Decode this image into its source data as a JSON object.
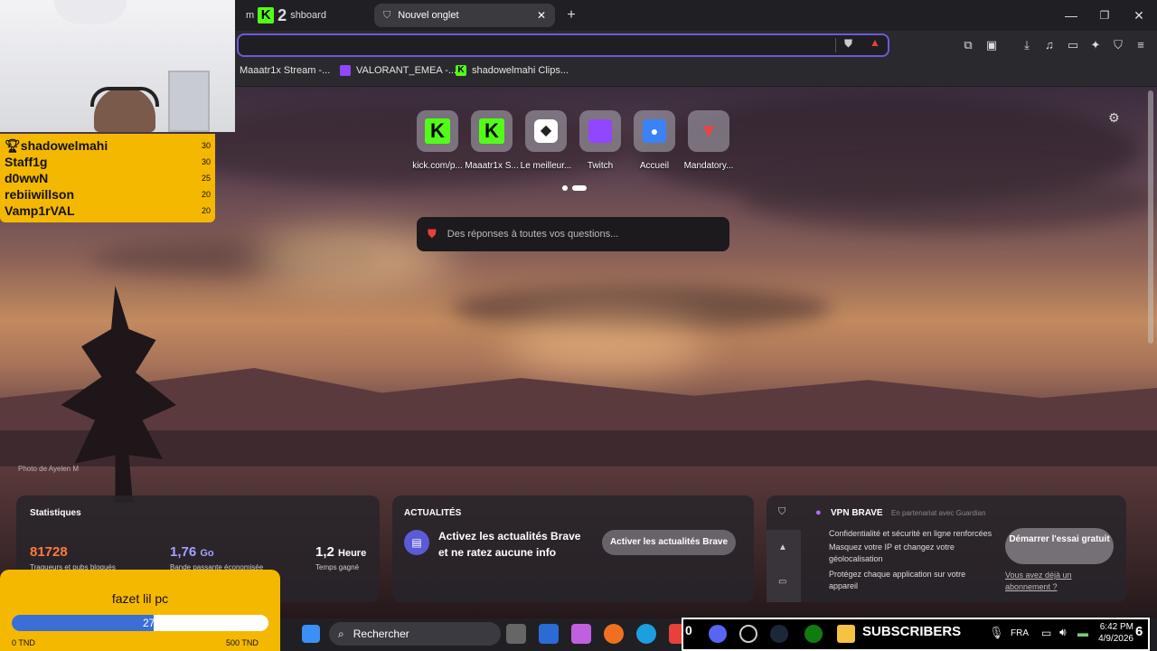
{
  "browser": {
    "tabs": [
      {
        "label": "shboard",
        "prefix": "m"
      },
      {
        "label": "Nouvel onglet"
      }
    ],
    "new_tab_symbol": "+",
    "window_controls": {
      "minimize": "—",
      "maximize": "❐",
      "close": "✕"
    },
    "bookmarks": [
      {
        "label": "Maaatr1x Stream -...",
        "icon": "kick"
      },
      {
        "label": "VALORANT_EMEA -...",
        "icon": "twitch"
      },
      {
        "label": "shadowelmahi Clips...",
        "icon": "kick"
      }
    ]
  },
  "newtab": {
    "shortcuts": [
      {
        "label": "kick.com/p...",
        "icon": "kick"
      },
      {
        "label": "Maaatr1x S...",
        "icon": "kick"
      },
      {
        "label": "Le meilleur...",
        "icon": "pixel"
      },
      {
        "label": "Twitch",
        "icon": "twitch"
      },
      {
        "label": "Accueil",
        "icon": "contact"
      },
      {
        "label": "Mandatory...",
        "icon": "mandatory"
      }
    ],
    "search_placeholder": "Des réponses à toutes vos questions...",
    "photo_credit": "Photo de Ayelen M",
    "stats": {
      "title": "Statistiques",
      "trackers_value": "81728",
      "trackers_label": "Traqueurs et pubs bloqués",
      "bandwidth_value": "1,76",
      "bandwidth_unit": "Go",
      "bandwidth_label": "Bande passante économisée",
      "time_value": "1,2",
      "time_unit": "Heure",
      "time_label": "Temps gagné"
    },
    "news": {
      "title": "ACTUALITÉS",
      "text": "Activez les actualités Brave et ne ratez aucune info",
      "button": "Activer les actualités Brave"
    },
    "vpn": {
      "title": "VPN BRAVE",
      "partner": "En partenariat avec",
      "partner_name": "Guardian",
      "features": [
        "Confidentialité et sécurité en ligne renforcées",
        "Masquez votre IP et changez votre géolocalisation",
        "Protégez chaque application sur votre appareil"
      ],
      "cta": "Démarrer l'essai gratuit",
      "link": "Vous avez déjà un abonnement ?"
    }
  },
  "overlays": {
    "kick_badge": "2",
    "leaderboard": [
      {
        "name": "shadowelmahi",
        "count": "30",
        "trophy": true
      },
      {
        "name": "Staff1g",
        "count": "30"
      },
      {
        "name": "d0wwN",
        "count": "25"
      },
      {
        "name": "rebiiwillson",
        "count": "20"
      },
      {
        "name": "Vamp1rVAL",
        "count": "20"
      }
    ],
    "goal": {
      "title": "fazet lil pc",
      "current": "276",
      "progress": 0.552,
      "min_label": "0 TND",
      "max_label": "500 TND"
    },
    "subscribers_label": "SUBSCRIBERS",
    "subscribers_count": "6"
  },
  "taskbar": {
    "search": "Rechercher",
    "lang": "FRA",
    "time": "6:42 PM",
    "date": "4/9/2026",
    "brave_badge": "0"
  }
}
